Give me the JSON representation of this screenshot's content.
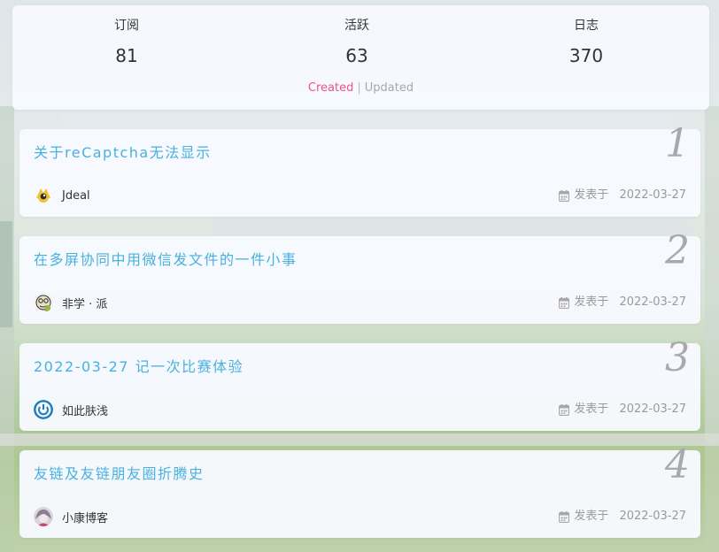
{
  "stats": [
    {
      "label": "订阅",
      "value": "81"
    },
    {
      "label": "活跃",
      "value": "63"
    },
    {
      "label": "日志",
      "value": "370"
    }
  ],
  "toggle": {
    "created": "Created",
    "separator": "|",
    "updated": "Updated"
  },
  "posts": [
    {
      "rank": "1",
      "title": "关于reCaptcha无法显示",
      "author": "Jdeal",
      "meta_label": "发表于",
      "date": "2022-03-27",
      "avatar_icon": "yellow-bird-avatar-icon"
    },
    {
      "rank": "2",
      "title": "在多屏协同中用微信发文件的一件小事",
      "author": "非学 · 派",
      "meta_label": "发表于",
      "date": "2022-03-27",
      "avatar_icon": "cartoon-face-avatar-icon"
    },
    {
      "rank": "3",
      "title": "2022-03-27 记一次比赛体验",
      "author": "如此肤浅",
      "meta_label": "发表于",
      "date": "2022-03-27",
      "avatar_icon": "power-symbol-avatar-icon"
    },
    {
      "rank": "4",
      "title": "友链及友链朋友圈折腾史",
      "author": "小康博客",
      "meta_label": "发表于",
      "date": "2022-03-27",
      "avatar_icon": "anime-girl-avatar-icon"
    }
  ],
  "colors": {
    "title": "#49b1e0",
    "created": "#e8558b",
    "rank": "#a9a9ad"
  }
}
